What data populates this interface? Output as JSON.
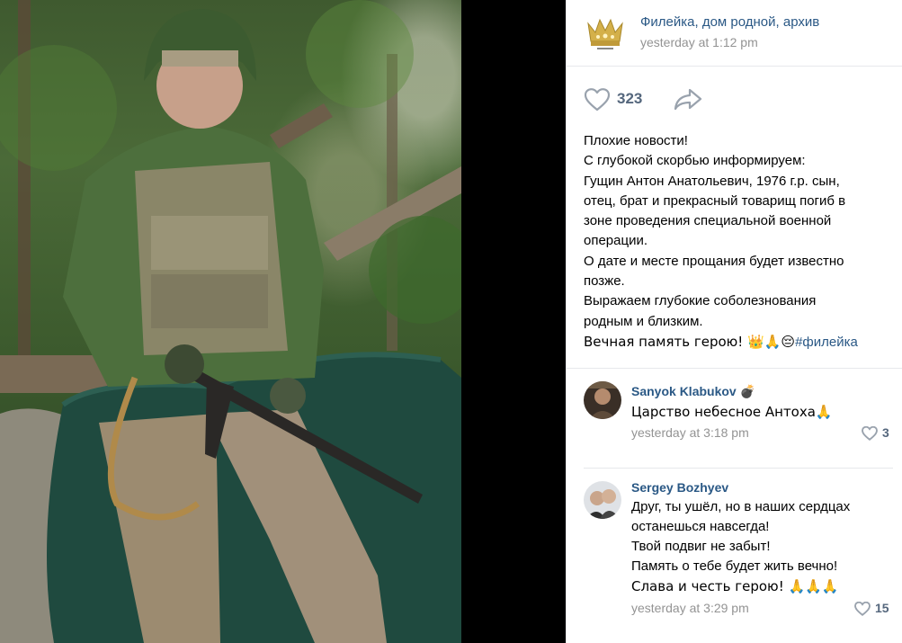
{
  "group": {
    "name": "Филейка, дом родной, архив",
    "time": "yesterday at 1:12 pm",
    "avatar_icon": "crown-icon"
  },
  "actions": {
    "likes": "323",
    "like_icon": "heart-icon",
    "share_icon": "share-arrow-icon"
  },
  "post": {
    "lines": [
      "Плохие новости!",
      "С глубокой скорбью информируем:",
      "Гущин Антон Анатольевич, 1976 г.р. сын,",
      "отец, брат и прекрасный товарищ погиб в",
      "зоне проведения специальной военной",
      "операции.",
      "О дате и месте прощания будет известно",
      "позже.",
      "Выражаем глубокие соболезнования",
      "родным и близким."
    ],
    "last_line_text": "Вечная память герою! 👑🙏😔",
    "hashtag": "#филейка"
  },
  "comments": [
    {
      "author": "Sanyok Klabukov",
      "author_emoji": "💣",
      "lines": [
        "Царство небесное Антоха🙏"
      ],
      "time": "yesterday at 3:18 pm",
      "likes": "3"
    },
    {
      "author": "Sergey Bozhyev",
      "author_emoji": "",
      "lines": [
        "Друг, ты ушёл, но в наших сердцах",
        "останешься навсегда!",
        "Твой подвиг не забыт!",
        "Память о тебе будет жить вечно!",
        "Слава и честь герою! 🙏🙏🙏"
      ],
      "time": "yesterday at 3:29 pm",
      "likes": "15"
    }
  ],
  "colors": {
    "link": "#2a5885",
    "meta": "#939393",
    "icon": "#99a2ad",
    "count": "#55677d"
  }
}
